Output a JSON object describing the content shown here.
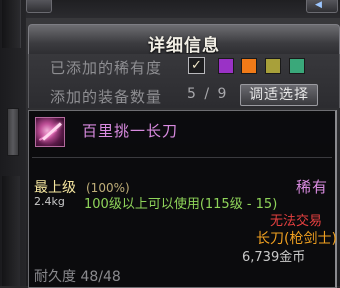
{
  "panel": {
    "title": "详细信息",
    "rarity_label": "已添加的稀有度",
    "equip_count_label": "添加的装备数量",
    "equip_count": "5 / 9",
    "adjust_button": "调适选择",
    "rarity_checked_glyph": "✓",
    "rarity_colors": [
      "#9a32c6",
      "#f07a18",
      "#a8a03a",
      "#3aa87a"
    ]
  },
  "item": {
    "icon": "weapon-longsword-icon",
    "name": "百里挑一长刀",
    "grade": "最上级",
    "grade_pct": "(100%)",
    "rarity": "稀有",
    "weight": "2.4kg",
    "requirement": "100级以上可以使用(115级 - 15)",
    "trade": "无法交易",
    "type": "长刀(枪剑士)",
    "price": "6,739金币",
    "durability": "耐久度 48/48"
  },
  "colors": {
    "rarity_text": "#d98be0",
    "grade_text": "#f6e7a0",
    "requirement_text": "#8fd45a",
    "trade_text": "#e64040",
    "type_text": "#f0a020"
  }
}
